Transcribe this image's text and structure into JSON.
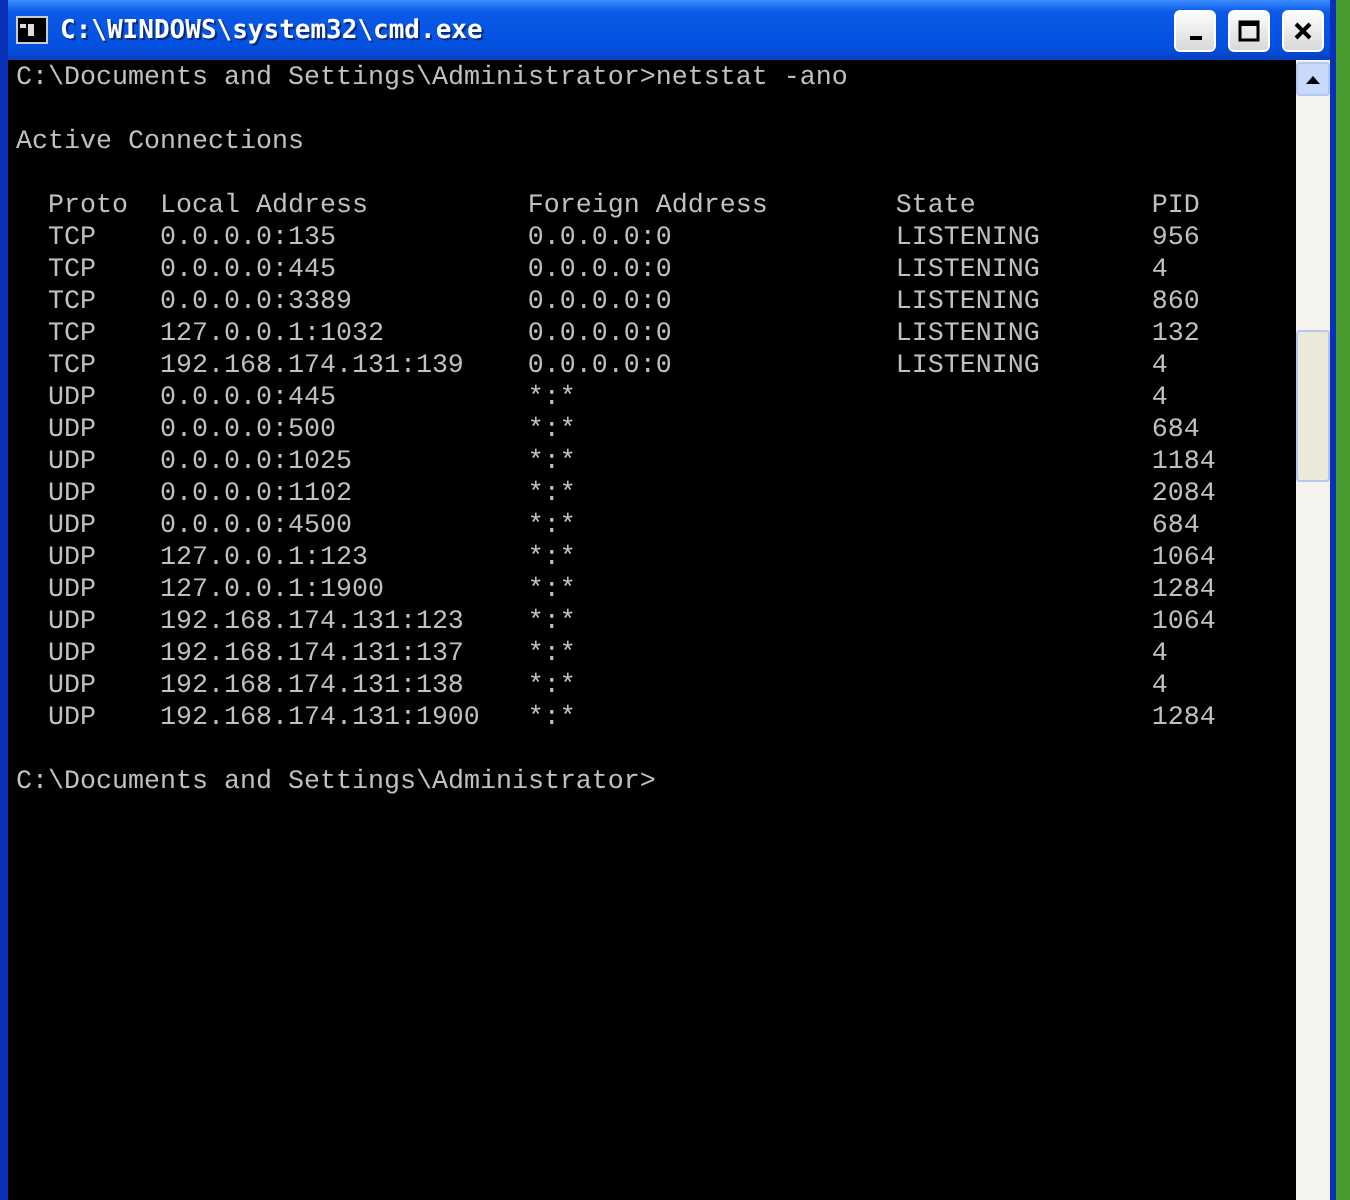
{
  "window": {
    "title": "C:\\WINDOWS\\system32\\cmd.exe"
  },
  "console": {
    "command_line": "C:\\Documents and Settings\\Administrator>netstat -ano",
    "heading": "Active Connections",
    "table": {
      "columns": [
        "Proto",
        "Local Address",
        "Foreign Address",
        "State",
        "PID"
      ],
      "rows": [
        {
          "proto": "TCP",
          "local": "0.0.0.0:135",
          "foreign": "0.0.0.0:0",
          "state": "LISTENING",
          "pid": "956"
        },
        {
          "proto": "TCP",
          "local": "0.0.0.0:445",
          "foreign": "0.0.0.0:0",
          "state": "LISTENING",
          "pid": "4"
        },
        {
          "proto": "TCP",
          "local": "0.0.0.0:3389",
          "foreign": "0.0.0.0:0",
          "state": "LISTENING",
          "pid": "860"
        },
        {
          "proto": "TCP",
          "local": "127.0.0.1:1032",
          "foreign": "0.0.0.0:0",
          "state": "LISTENING",
          "pid": "132"
        },
        {
          "proto": "TCP",
          "local": "192.168.174.131:139",
          "foreign": "0.0.0.0:0",
          "state": "LISTENING",
          "pid": "4"
        },
        {
          "proto": "UDP",
          "local": "0.0.0.0:445",
          "foreign": "*:*",
          "pid": "4"
        },
        {
          "proto": "UDP",
          "local": "0.0.0.0:500",
          "foreign": "*:*",
          "pid": "684"
        },
        {
          "proto": "UDP",
          "local": "0.0.0.0:1025",
          "foreign": "*:*",
          "pid": "1184"
        },
        {
          "proto": "UDP",
          "local": "0.0.0.0:1102",
          "foreign": "*:*",
          "pid": "2084"
        },
        {
          "proto": "UDP",
          "local": "0.0.0.0:4500",
          "foreign": "*:*",
          "pid": "684"
        },
        {
          "proto": "UDP",
          "local": "127.0.0.1:123",
          "foreign": "*:*",
          "pid": "1064"
        },
        {
          "proto": "UDP",
          "local": "127.0.0.1:1900",
          "foreign": "*:*",
          "pid": "1284"
        },
        {
          "proto": "UDP",
          "local": "192.168.174.131:123",
          "foreign": "*:*",
          "pid": "1064"
        },
        {
          "proto": "UDP",
          "local": "192.168.174.131:137",
          "foreign": "*:*",
          "pid": "4"
        },
        {
          "proto": "UDP",
          "local": "192.168.174.131:138",
          "foreign": "*:*",
          "pid": "4"
        },
        {
          "proto": "UDP",
          "local": "192.168.174.131:1900",
          "foreign": "*:*",
          "pid": "1284"
        }
      ]
    },
    "prompt": "C:\\Documents and Settings\\Administrator>"
  }
}
